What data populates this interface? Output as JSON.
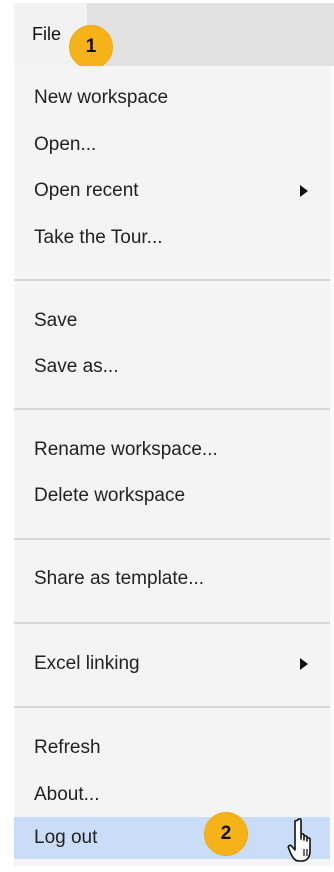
{
  "menubar": {
    "file_label": "File"
  },
  "menu": {
    "items": [
      {
        "label": "New workspace"
      },
      {
        "label": "Open..."
      },
      {
        "label": "Open recent",
        "submenu": true
      },
      {
        "label": "Take the Tour..."
      },
      {
        "label": "Save"
      },
      {
        "label": "Save as..."
      },
      {
        "label": "Rename workspace..."
      },
      {
        "label": "Delete workspace"
      },
      {
        "label": "Share as template..."
      },
      {
        "label": "Excel linking",
        "submenu": true
      },
      {
        "label": "Refresh"
      },
      {
        "label": "About..."
      },
      {
        "label": "Log out",
        "highlighted": true
      }
    ]
  },
  "callouts": {
    "step1": "1",
    "step2": "2"
  },
  "icons": {
    "submenu": "triangle-right-icon",
    "pointer": "hand-pointer-icon"
  },
  "colors": {
    "menubar": "#e1e1e1",
    "menu_background": "#f4f4f4",
    "highlight": "#c9ddf8",
    "callout_badge": "#f6b219"
  }
}
